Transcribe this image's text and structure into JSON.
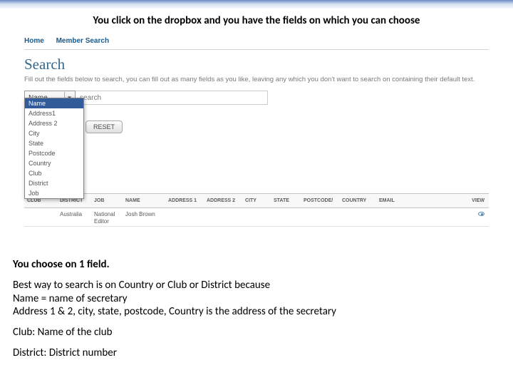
{
  "caption": "You click on the dropbox and you have the fields on which you can choose",
  "nav": {
    "home": "Home",
    "member_search": "Member Search"
  },
  "search": {
    "title": "Search",
    "description": "Fill out the fields below to search, you can fill out as many fields as you like, leaving any which you don't want to search on containing their default text.",
    "selected": "Name",
    "placeholder": "search",
    "reset_label": "RESET",
    "options": [
      "Name",
      "Address1",
      "Address 2",
      "City",
      "State",
      "Postcode",
      "Country",
      "Club",
      "District",
      "Job"
    ]
  },
  "table": {
    "headers": {
      "club": "CLUB",
      "district": "DISTRICT",
      "job": "JOB",
      "name": "NAME",
      "addr1": "ADDRESS 1",
      "addr2": "ADDRESS 2",
      "city": "CITY",
      "state": "STATE",
      "postcode": "POSTCODE/",
      "country": "COUNTRY",
      "email": "EMAIL",
      "view": "VIEW"
    },
    "row": {
      "club": "",
      "district": "Australia",
      "job": "National Editor",
      "name": "Josh Brown"
    }
  },
  "instructions": {
    "line1": "You choose on 1 field.",
    "line2a": "Best way to search is on Country or Club or District because",
    "line2b": "Name = name of secretary",
    "line2c": "Address 1 & 2, city, state, postcode, Country is the address of the secretary",
    "line3": "Club: Name of the club",
    "line4": "District: District number"
  }
}
